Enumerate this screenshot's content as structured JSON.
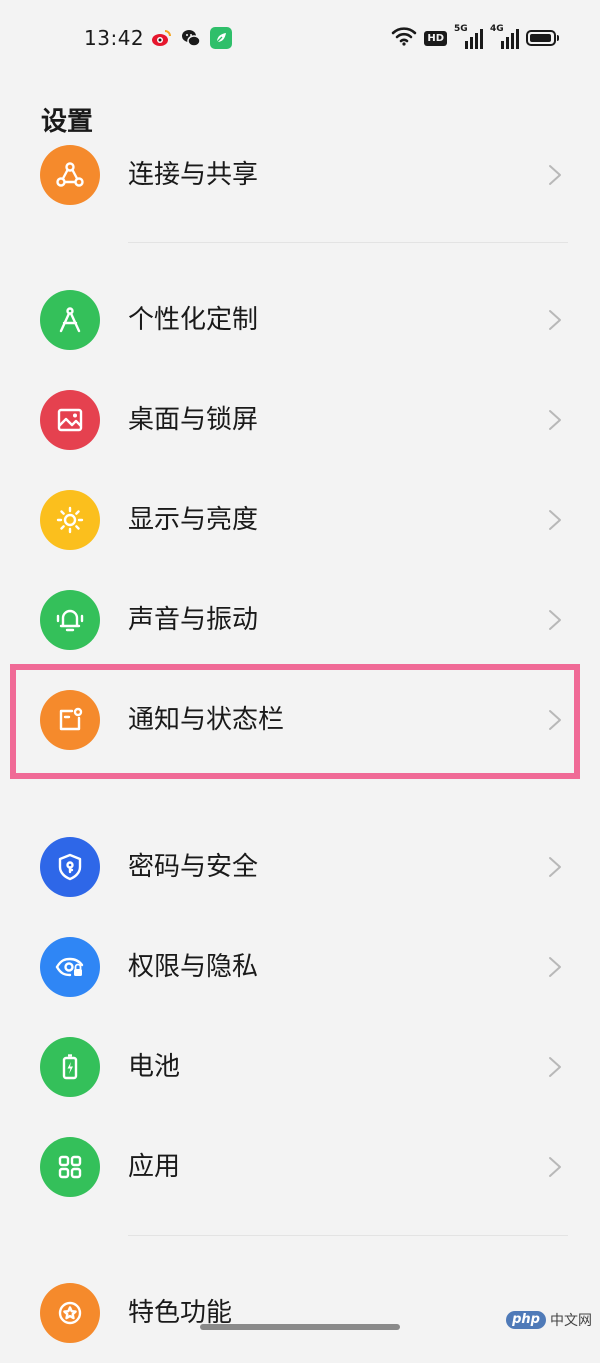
{
  "status_bar": {
    "time": "13:42",
    "hd": "HD",
    "net1": "5G",
    "net2": "4G",
    "battery_fraction": 0.95
  },
  "page": {
    "title": "设置"
  },
  "settings": [
    {
      "label": "连接与共享",
      "icon": "share-nodes-icon",
      "color": "#f58a2c"
    },
    {
      "label": "个性化定制",
      "icon": "compass-icon",
      "color": "#34c05a"
    },
    {
      "label": "桌面与锁屏",
      "icon": "image-icon",
      "color": "#e5414f"
    },
    {
      "label": "显示与亮度",
      "icon": "sun-icon",
      "color": "#fbbf1d"
    },
    {
      "label": "声音与振动",
      "icon": "bell-icon",
      "color": "#34c05a"
    },
    {
      "label": "通知与状态栏",
      "icon": "notification-icon",
      "color": "#f58a2c"
    },
    {
      "label": "密码与安全",
      "icon": "shield-icon",
      "color": "#2e67e8"
    },
    {
      "label": "权限与隐私",
      "icon": "eye-icon",
      "color": "#2f86f5"
    },
    {
      "label": "电池",
      "icon": "battery-icon",
      "color": "#34c05a"
    },
    {
      "label": "应用",
      "icon": "apps-grid-icon",
      "color": "#34c05a"
    },
    {
      "label": "特色功能",
      "icon": "star-icon",
      "color": "#f58a2c"
    }
  ],
  "watermark": {
    "php": "php",
    "cn": "中文网"
  }
}
